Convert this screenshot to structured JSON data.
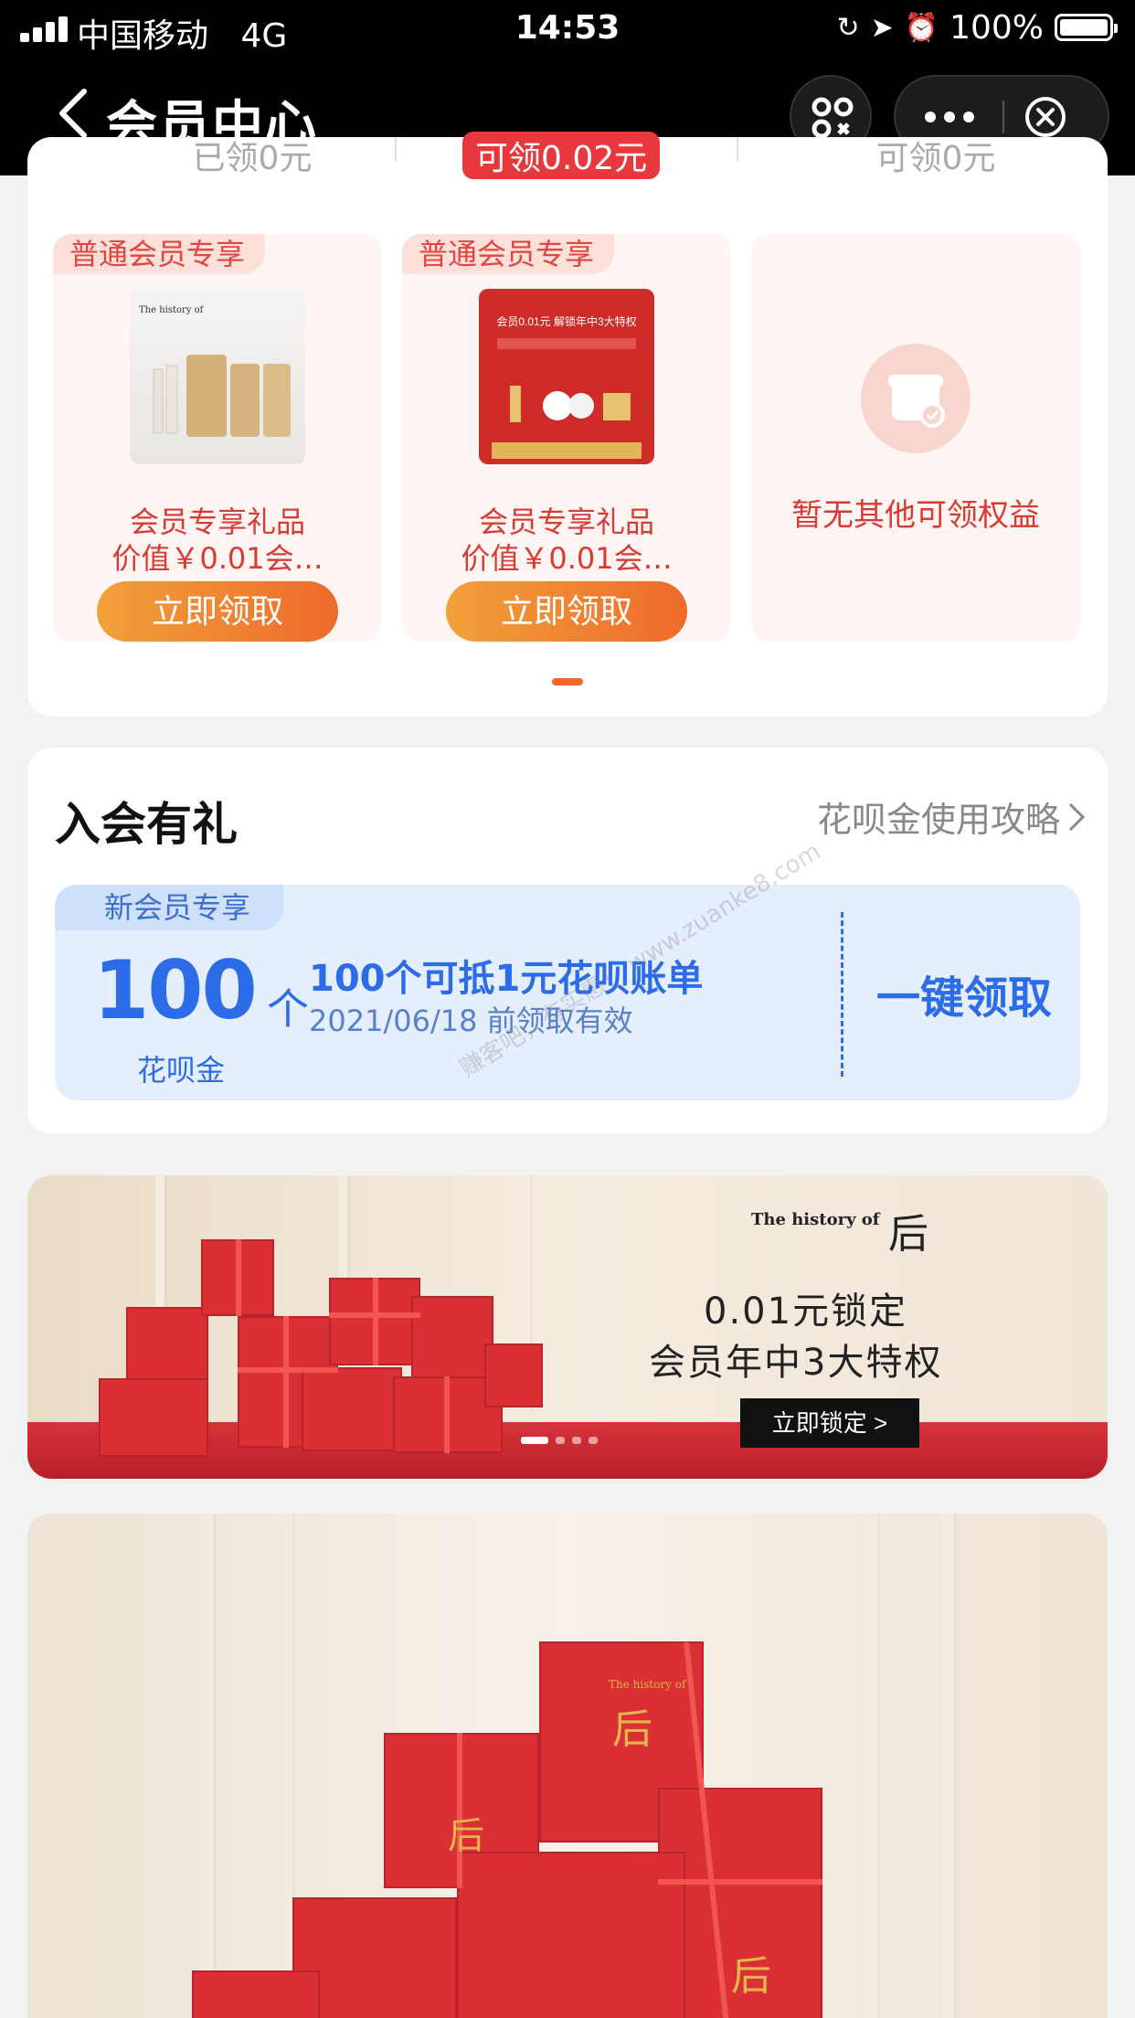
{
  "status_bar": {
    "carrier": "中国移动",
    "network": "4G",
    "time": "14:53",
    "battery": "100%",
    "battery_level": 1.0,
    "icons": [
      "orientation-lock-icon",
      "location-arrow-icon",
      "alarm-icon"
    ]
  },
  "nav": {
    "title": "会员中心",
    "back_icon": "chevron-left-icon",
    "scan_icon": "scan-icon",
    "more_icon": "more-dots-icon",
    "close_icon": "close-circle-icon"
  },
  "stages": [
    {
      "label": "已领0元",
      "active": false
    },
    {
      "label": "可领0.02元",
      "active": true
    },
    {
      "label": "可领0元",
      "active": false
    }
  ],
  "gifts": [
    {
      "tag": "普通会员专享",
      "line1": "会员专享礼品",
      "line2": "价值￥0.01会…",
      "button": "立即领取"
    },
    {
      "tag": "普通会员专享",
      "line1": "会员专享礼品",
      "line2": "价值￥0.01会…",
      "button": "立即领取"
    }
  ],
  "gift_empty": {
    "text": "暂无其他可领权益"
  },
  "thumb2": {
    "title": "会员0.01元 解锁年中3大特权"
  },
  "join_gift": {
    "title": "入会有礼",
    "link": "花呗金使用攻略",
    "coupon": {
      "tag": "新会员专享",
      "amount": "100",
      "unit": "个",
      "label": "花呗金",
      "title": "100个可抵1元花呗账单",
      "validity": "2021/06/18 前领取有效",
      "button": "一键领取"
    }
  },
  "banner1": {
    "brand": "The history of",
    "logo": "后",
    "line1": "0.01元锁定",
    "line2": "会员年中3大特权",
    "button": "立即锁定 >",
    "slides": 4,
    "active_slide": 0
  },
  "banner2": {
    "brand": "The history of",
    "logo": "后"
  },
  "watermark": "赚客吧，有实惠！ www.zuanke8.com",
  "colors": {
    "accent_red": "#e8383d",
    "button_orange": "#ee6a2b",
    "coupon_blue": "#2c6ce8"
  }
}
